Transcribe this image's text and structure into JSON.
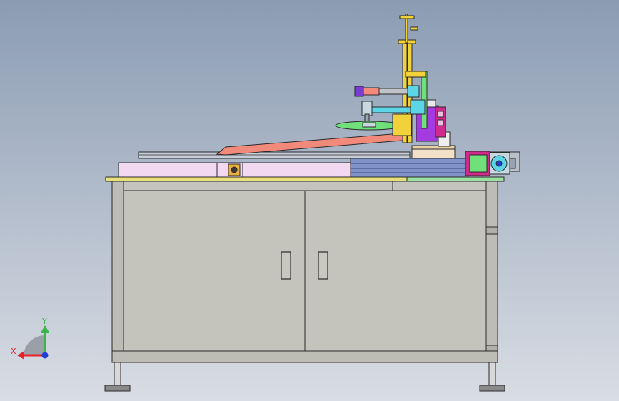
{
  "viewport": {
    "background_top": "#8b9cb3",
    "background_bottom": "#d9dde4"
  },
  "triad": {
    "x_label": "X",
    "y_label": "Y",
    "x_color": "#e8232a",
    "y_color": "#3bb54a",
    "z_color": "#1f3fd6"
  },
  "colors": {
    "cabinet": "#c4c4bd",
    "cabinet_outline": "#3a3a3a",
    "tabletop": "#e6e07a",
    "rail": "#7f93c8",
    "pink_panel": "#f2d8f0",
    "arm_salmon": "#f28a7c",
    "purple_block": "#a43be0",
    "magenta_motor": "#d02a8c",
    "cyan_part": "#5cd6e6",
    "green_part": "#6fe07a",
    "yellow_column": "#f2d23a"
  }
}
